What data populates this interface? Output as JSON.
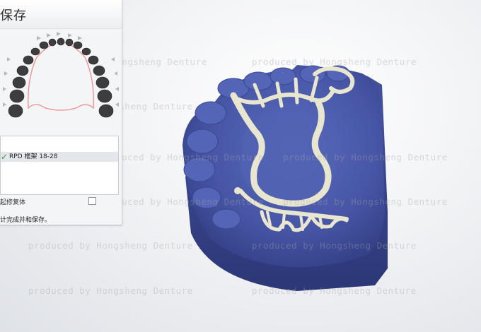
{
  "panel": {
    "title": "保存",
    "list_items": [
      {
        "label": "RPD 框架 18-28",
        "checked": true
      }
    ],
    "option_label": "起修复体",
    "option_checked": false,
    "status_text": "计完成并和保存。"
  },
  "watermark_text": "produced by Hongsheng Denture",
  "colors": {
    "model_blue": "#4a5aa8",
    "framework_ivory": "#e9e6cf",
    "arch_outline": "#f08a8a",
    "check_green": "#2f9a3a"
  }
}
